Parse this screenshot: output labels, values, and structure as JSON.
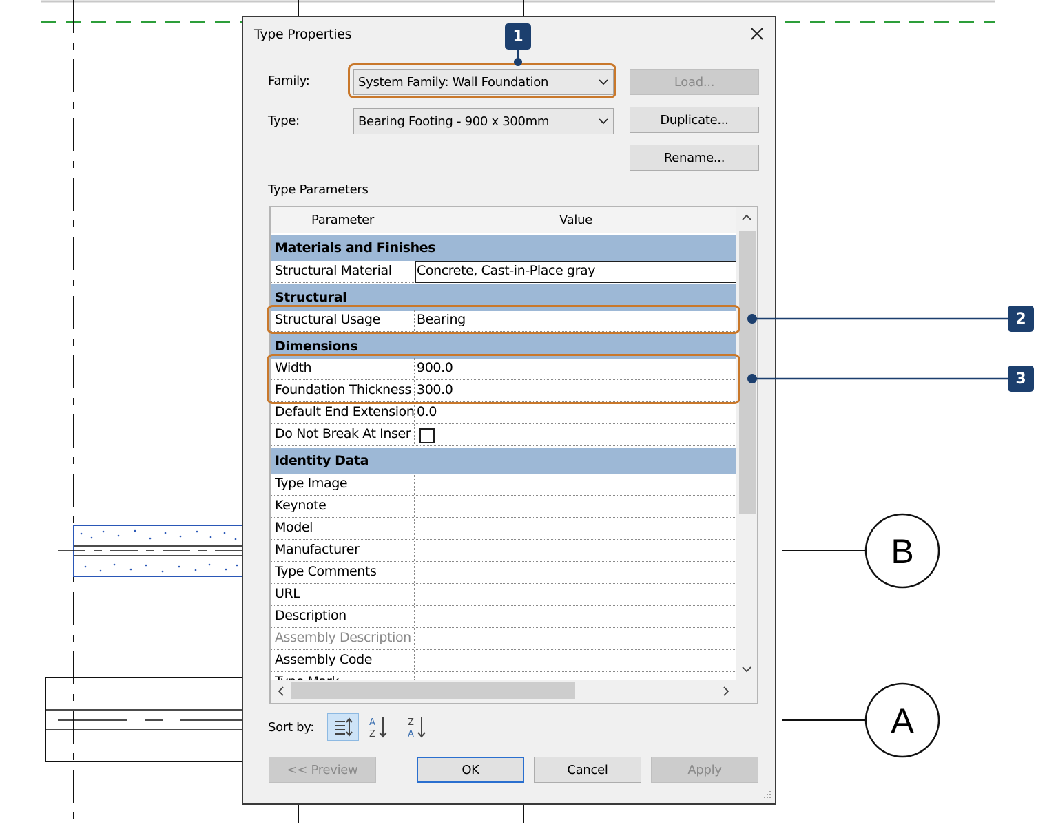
{
  "dialog": {
    "title": "Type Properties",
    "close_icon": "close-icon",
    "family_label": "Family:",
    "family_value": "System Family: Wall Foundation",
    "type_label": "Type:",
    "type_value": "Bearing Footing - 900 x 300mm",
    "load_button": "Load...",
    "duplicate_button": "Duplicate...",
    "rename_button": "Rename...",
    "type_parameters_label": "Type Parameters",
    "grid": {
      "col_parameter": "Parameter",
      "col_value": "Value",
      "groups": {
        "materials": "Materials and Finishes",
        "structural": "Structural",
        "dimensions": "Dimensions",
        "identity": "Identity Data"
      },
      "rows": {
        "structural_material": {
          "name": "Structural Material",
          "value": "Concrete, Cast-in-Place gray"
        },
        "structural_usage": {
          "name": "Structural Usage",
          "value": "Bearing"
        },
        "width": {
          "name": "Width",
          "value": "900.0"
        },
        "foundation_thickness": {
          "name": "Foundation Thickness",
          "value": "300.0"
        },
        "default_end_extension": {
          "name": "Default End Extension",
          "value": "0.0"
        },
        "do_not_break": {
          "name": "Do Not Break At Inser",
          "checked": false
        },
        "type_image": {
          "name": "Type Image",
          "value": ""
        },
        "keynote": {
          "name": "Keynote",
          "value": ""
        },
        "model": {
          "name": "Model",
          "value": ""
        },
        "manufacturer": {
          "name": "Manufacturer",
          "value": ""
        },
        "type_comments": {
          "name": "Type Comments",
          "value": ""
        },
        "url": {
          "name": "URL",
          "value": ""
        },
        "description": {
          "name": "Description",
          "value": ""
        },
        "assembly_description": {
          "name": "Assembly Description",
          "value": ""
        },
        "assembly_code": {
          "name": "Assembly Code",
          "value": ""
        },
        "type_mark": {
          "name": "Type Mark",
          "value": ""
        }
      }
    },
    "sort_label": "Sort by:",
    "sort_icons": [
      "sort-grouped-icon",
      "sort-ascending-icon",
      "sort-descending-icon"
    ],
    "preview_button": "<< Preview",
    "ok_button": "OK",
    "cancel_button": "Cancel",
    "apply_button": "Apply"
  },
  "callouts": {
    "one": "1",
    "two": "2",
    "three": "3"
  },
  "grid_labels": {
    "b": "B",
    "a": "A"
  },
  "colors": {
    "highlight": "#c9782b",
    "callout": "#1c3f6e",
    "group_header": "#9db8d6",
    "guide_dash": "#2d9e3a"
  }
}
